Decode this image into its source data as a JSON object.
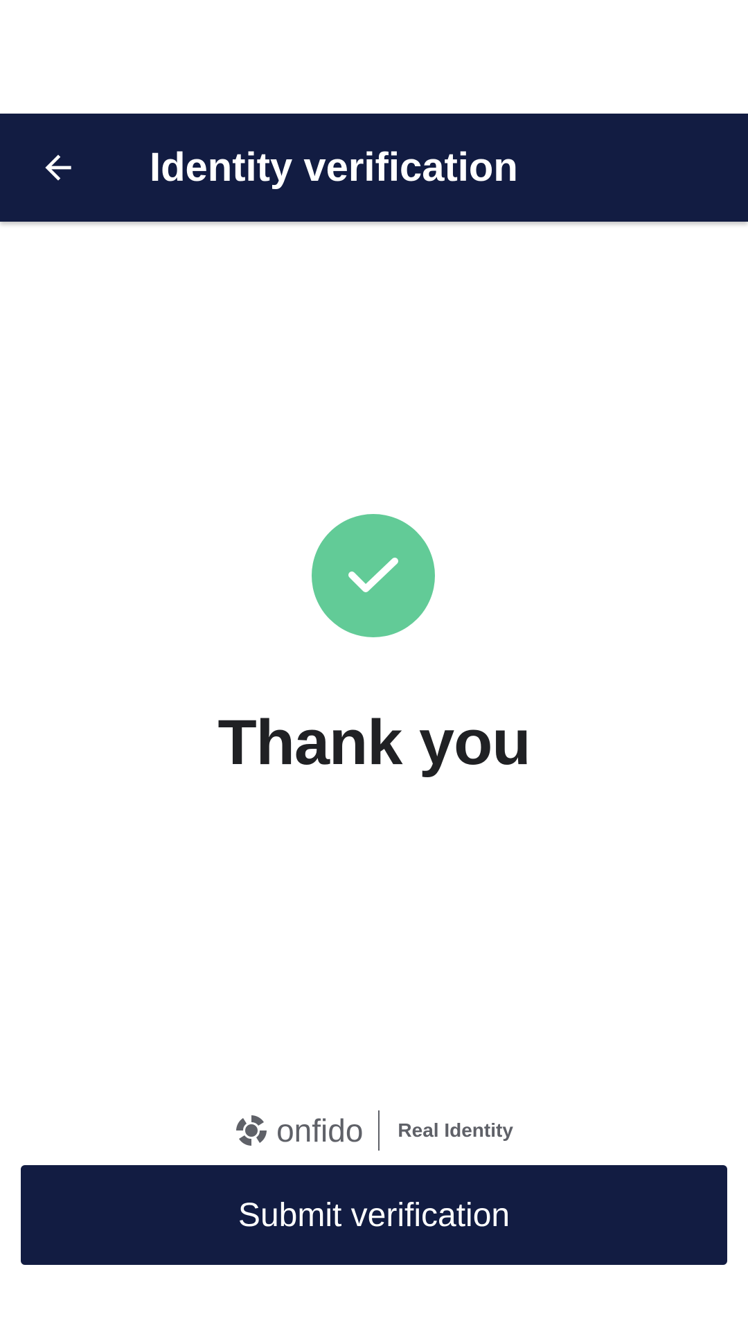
{
  "app_bar": {
    "back_icon": "arrow-left-icon",
    "title": "Identity verification",
    "background_color": "#121c42"
  },
  "main": {
    "success_icon": "checkmark-icon",
    "success_color": "#62cb97",
    "heading": "Thank you"
  },
  "branding": {
    "logo_name": "onfido",
    "tagline": "Real Identity"
  },
  "footer": {
    "submit_label": "Submit verification"
  }
}
